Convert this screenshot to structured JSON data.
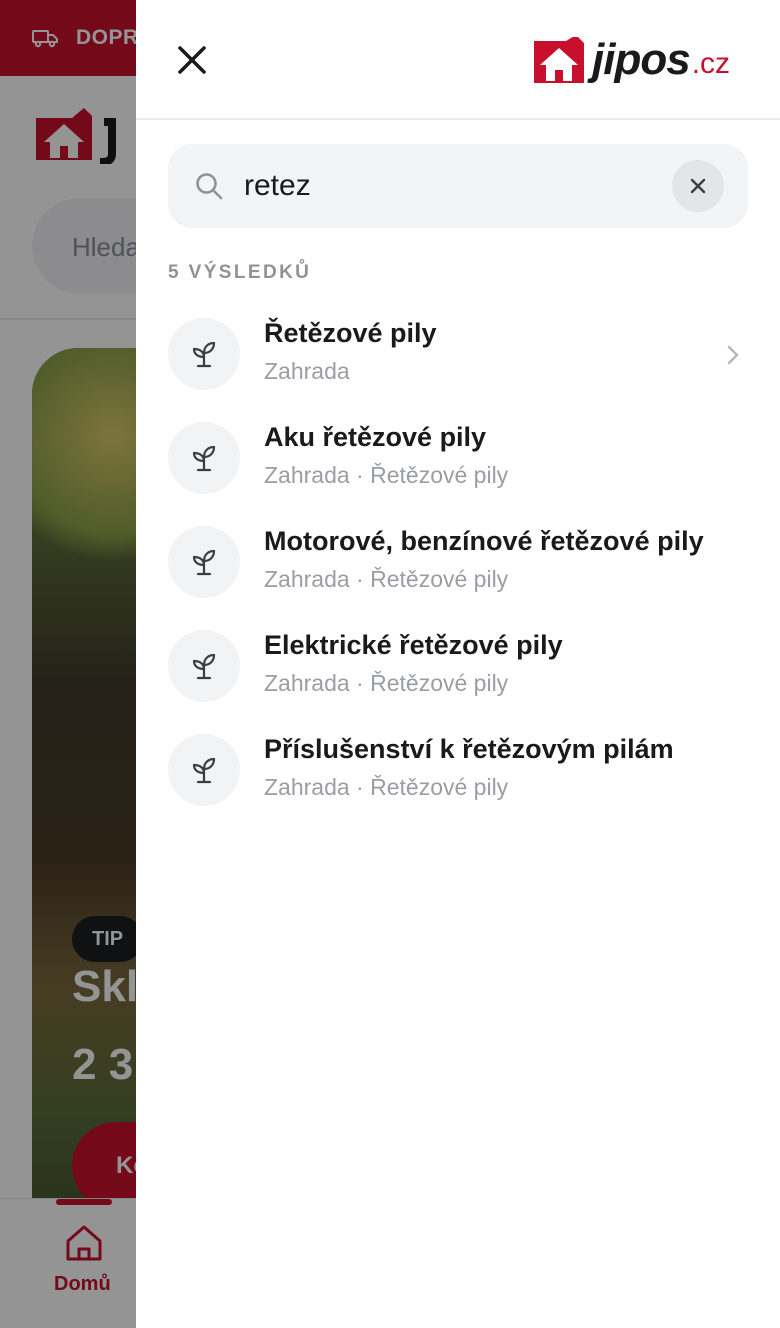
{
  "background": {
    "topbar_text": "DOPR",
    "search_placeholder": "Hleda",
    "tip_badge": "TIP",
    "hero_heading": "Skl",
    "hero_price": "2 3",
    "hero_cta": "Ko",
    "bottom_nav_home": "Domů"
  },
  "drawer": {
    "logo": {
      "brand": "jipos",
      "tld": ".cz"
    },
    "search": {
      "value": "retez"
    },
    "result_count": "5 VÝSLEDKŮ",
    "results": [
      {
        "title": "Řetězové pily",
        "path": "Zahrada"
      },
      {
        "title": "Aku řetězové pily",
        "path": "Zahrada · Řetězové pily"
      },
      {
        "title": "Motorové, benzínové řetězové pily",
        "path": "Zahrada · Řetězové pily"
      },
      {
        "title": "Elektrické řetězové pily",
        "path": "Zahrada · Řetězové pily"
      },
      {
        "title": "Příslušenství k řetězovým pilám",
        "path": "Zahrada · Řetězové pily"
      }
    ]
  },
  "colors": {
    "brand": "#c8102e",
    "muted": "#9a9da3",
    "text": "#1a1a1a"
  }
}
